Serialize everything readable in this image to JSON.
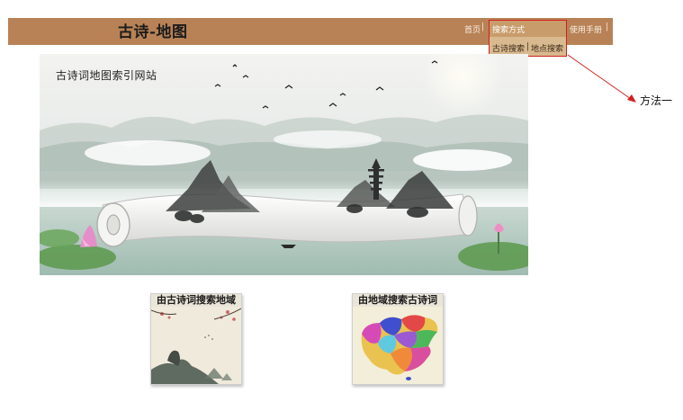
{
  "header": {
    "site_title": "古诗-地图",
    "nav": {
      "home_label": "首页",
      "search_mode_label": "搜索方式",
      "manual_label": "使用手册",
      "separator": "|"
    },
    "dropdown": {
      "poem_search_label": "古诗搜索",
      "place_search_label": "地点搜索",
      "separator": "|"
    }
  },
  "annotation": {
    "label": "方法一",
    "color": "#d0201e"
  },
  "banner": {
    "caption": "古诗词地图索引网站"
  },
  "cards": [
    {
      "title": "由古诗词搜索地域"
    },
    {
      "title": "由地域搜索古诗词"
    }
  ],
  "colors": {
    "header_bg": "#b88256",
    "dropdown_bg": "#d9b98f",
    "highlight_border": "#d0201e"
  }
}
